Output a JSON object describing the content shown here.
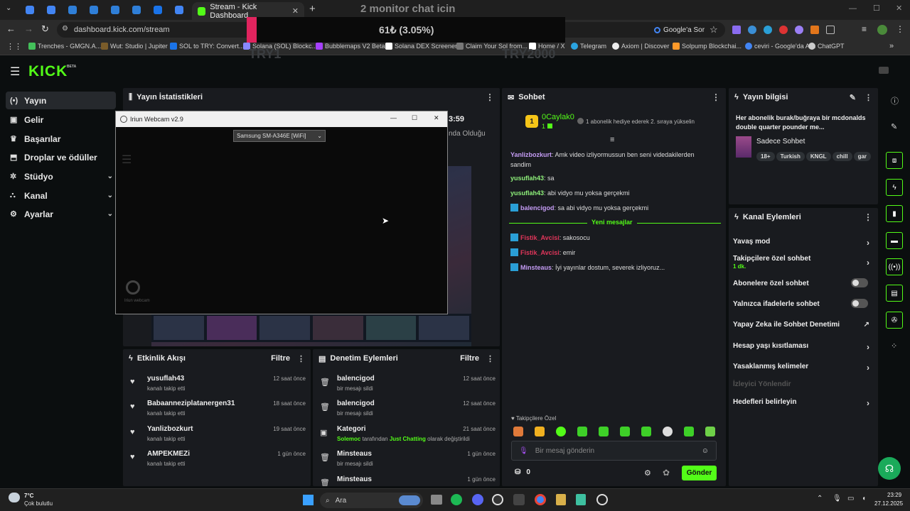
{
  "browser": {
    "tabs": [
      {
        "label": "Stream - Kick Dashboard"
      }
    ],
    "new_tab": "+",
    "url": "dashboard.kick.com/stream",
    "google_btn": "Google'a Sor",
    "bookmarks": [
      {
        "label": "Trenches - GMGN.A...",
        "color": "#43c05a"
      },
      {
        "label": "Wut: Studio | Jupiter",
        "color": "#7a5c2a"
      },
      {
        "label": "SOL to TRY: Convert...",
        "color": "#1a73e8"
      },
      {
        "label": "Solana (SOL) Blockc...",
        "color": "#8888ff"
      },
      {
        "label": "Bubblemaps V2 Beta",
        "color": "#a640ff"
      },
      {
        "label": "Solana DEX Screener",
        "color": "#ffffff"
      },
      {
        "label": "Claim Your Sol from...",
        "color": "#777"
      },
      {
        "label": "Home / X",
        "color": "#ffffff"
      },
      {
        "label": "Telegram",
        "color": "#2aa3e0"
      },
      {
        "label": "Axiom | Discover",
        "color": "#eeeeee"
      },
      {
        "label": "Solpump Blockchai...",
        "color": "#ff9a2a"
      },
      {
        "label": "ceviri - Google'da Ara",
        "color": "#4285f4"
      },
      {
        "label": "ChatGPT",
        "color": "#cccccc"
      }
    ]
  },
  "overlay": {
    "title": "2 monitor chat icin",
    "value": "61₺ (3.05%)",
    "left": "TRY1",
    "right": "TRY2000"
  },
  "kick": {
    "logo": "KICK",
    "beta": "BETA",
    "nav": [
      {
        "label": "Yayın",
        "icon": "(•)",
        "active": true
      },
      {
        "label": "Gelir",
        "icon": "▣"
      },
      {
        "label": "Başarılar",
        "icon": "♛"
      },
      {
        "label": "Droplar ve ödüller",
        "icon": "⬒"
      },
      {
        "label": "Stüdyo",
        "icon": "✲",
        "chev": true
      },
      {
        "label": "Kanal",
        "icon": "⛬",
        "chev": true
      },
      {
        "label": "Ayarlar",
        "icon": "⚙",
        "chev": true
      }
    ]
  },
  "stats": {
    "title": "Yayın İstatistikleri",
    "time": "3:59",
    "partial": "nda Olduğu"
  },
  "webcam": {
    "title": "Iriun Webcam v2.9",
    "device": "Samsung SM-A346E [WiFi]",
    "logo_label": "Iriun webcam",
    "min": "—",
    "max": "☐",
    "close": "✕"
  },
  "activity": {
    "title": "Etkinlik Akışı",
    "filter": "Filtre",
    "items": [
      {
        "name": "yusuflah43",
        "sub": "kanalı takip etti",
        "time": "12 saat önce"
      },
      {
        "name": "Babaanneziplatanergen31",
        "sub": "kanalı takip etti",
        "time": "18 saat önce"
      },
      {
        "name": "Yanlizbozkurt",
        "sub": "kanalı takip etti",
        "time": "19 saat önce"
      },
      {
        "name": "AMPEKMEZi",
        "sub": "kanalı takip etti",
        "time": "1 gün önce"
      }
    ]
  },
  "moderation": {
    "title": "Denetim Eylemleri",
    "filter": "Filtre",
    "items": [
      {
        "name": "balencigod",
        "sub": "bir mesajı sildi",
        "time": "12 saat önce"
      },
      {
        "name": "balencigod",
        "sub": "bir mesajı sildi",
        "time": "12 saat önce"
      },
      {
        "name": "Kategori",
        "sub_user": "Solemoc",
        "sub_a": " tarafından ",
        "sub_cat": "Just Chatting",
        "sub_b": " olarak değiştirildi",
        "time": "21 saat önce"
      },
      {
        "name": "Minsteaus",
        "sub": "bir mesajı sildi",
        "time": "1 gün önce"
      },
      {
        "name": "Minsteaus",
        "sub": "",
        "time": "1 gün önce"
      }
    ]
  },
  "chat": {
    "title": "Sohbet",
    "top_user": "0Caylak0",
    "top_rank": "1",
    "top_count": "1",
    "promo": "1 abonelik hediye ederek 2. sıraya yükselin",
    "messages": [
      {
        "user": "Yanlizbozkurt",
        "color": "#c59cf5",
        "text": ": Amk video izliyormussun ben seni videdakilerden sandim"
      },
      {
        "user": "yusuflah43",
        "color": "#8ef07a",
        "text": ": sa"
      },
      {
        "user": "yusuflah43",
        "color": "#8ef07a",
        "text": ": abi vidyo mu yoksa gerçekmi"
      },
      {
        "user": "balencigod",
        "color": "#c59cf5",
        "text": ": sa abi vidyo mu yoksa gerçekmi"
      }
    ],
    "new_label": "Yeni mesajlar",
    "new_messages": [
      {
        "user": "Fistik_Avcisi",
        "color": "#e0355a",
        "text": ": sakosocu"
      },
      {
        "user": "Fistik_Avcisi",
        "color": "#e0355a",
        "text": ": emir"
      },
      {
        "user": "Minsteaus",
        "color": "#c59cf5",
        "text": ": İyi yayınlar dostum, severek izliyoruz..."
      }
    ],
    "followers_only": "Takipçilere Özel",
    "input_placeholder": "Bir mesaj gönderin",
    "points": "0",
    "send": "Gönder"
  },
  "info": {
    "title": "Yayın bilgisi",
    "stream_title": "Her abonelik burak/buğraya bir mcdonalds double quarter pounder me...",
    "category": "Sadece Sohbet",
    "tags": [
      "18+",
      "Turkish",
      "KNGL",
      "chill",
      "gar"
    ]
  },
  "channel_actions": {
    "title": "Kanal Eylemleri",
    "rows": [
      {
        "label": "Yavaş mod",
        "type": "arrow"
      },
      {
        "label": "Takipçilere özel sohbet",
        "sub": "1 dk.",
        "type": "arrow"
      },
      {
        "label": "Abonelere özel sohbet",
        "type": "toggle"
      },
      {
        "label": "Yalnızca ifadelerle sohbet",
        "type": "toggle"
      },
      {
        "label": "Yapay Zeka ile Sohbet Denetimi",
        "type": "ext"
      },
      {
        "label": "Hesap yaşı kısıtlaması",
        "type": "arrow"
      },
      {
        "label": "Yasaklanmış kelimeler",
        "type": "arrow"
      },
      {
        "label": "İzleyici Yönlendir",
        "type": "disabled"
      },
      {
        "label": "Hedefleri belirleyin",
        "type": "arrow"
      }
    ]
  },
  "taskbar": {
    "weather_temp": "7°C",
    "weather_desc": "Çok bulutlu",
    "search": "Ara",
    "time": "23:29",
    "date": "27.12.2025"
  },
  "colors": {
    "accent": "#53fc18",
    "panel": "#191b1f",
    "bg": "#0b0e0f"
  }
}
